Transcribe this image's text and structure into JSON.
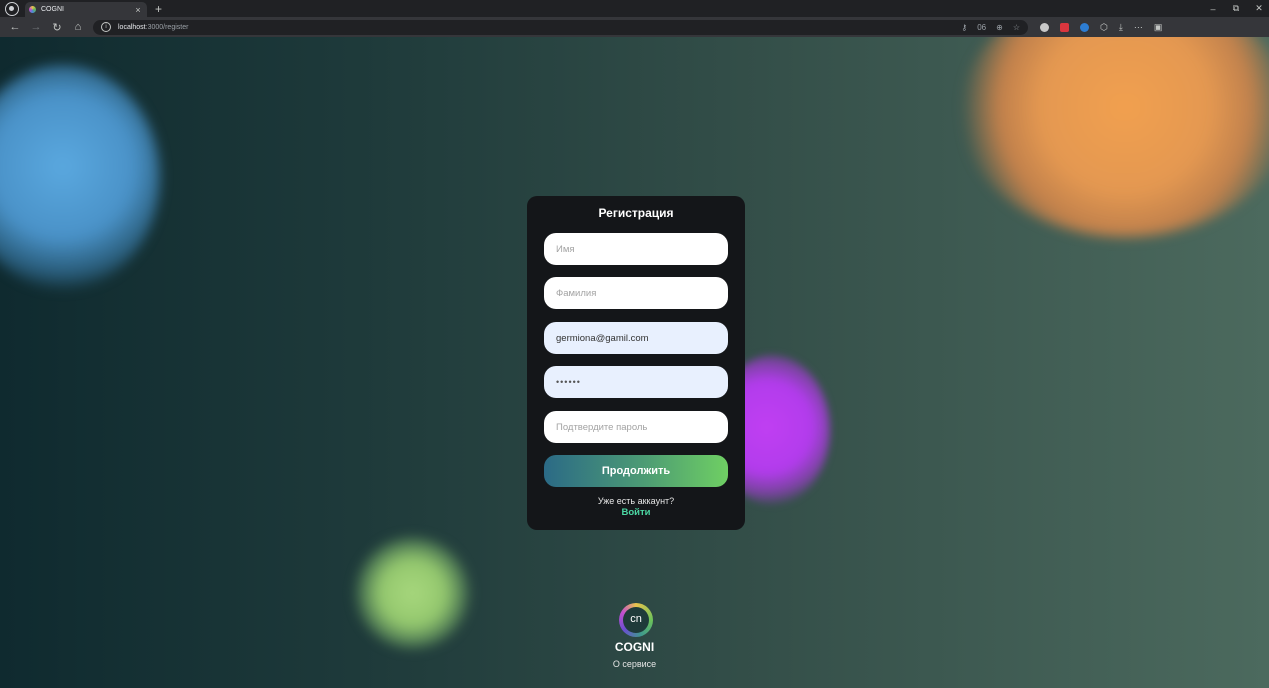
{
  "browser": {
    "tab_title": "COGNI",
    "tab_close": "×",
    "new_tab": "+",
    "url_host": "localhost",
    "url_path": ":3000/register",
    "omnibox_badge": "06",
    "window_minimize": "–",
    "window_restore": "⧉",
    "window_close": "✕"
  },
  "form": {
    "title": "Регистрация",
    "first_name_placeholder": "Имя",
    "last_name_placeholder": "Фамилия",
    "email_value": "germiona@gamil.com",
    "password_value": "••••••",
    "confirm_placeholder": "Подтвердите пароль",
    "submit_label": "Продолжить",
    "have_account": "Уже есть аккаунт?",
    "login_link": "Войти"
  },
  "footer": {
    "logo_text": "cn",
    "brand": "COGNI",
    "about_link": "О сервисе"
  },
  "colors": {
    "card_bg": "#141619",
    "accent_green": "#4cd8a4",
    "button_gradient_start": "#2b6a86",
    "button_gradient_end": "#6fcf63",
    "autofill_bg": "#e8f0fe"
  }
}
